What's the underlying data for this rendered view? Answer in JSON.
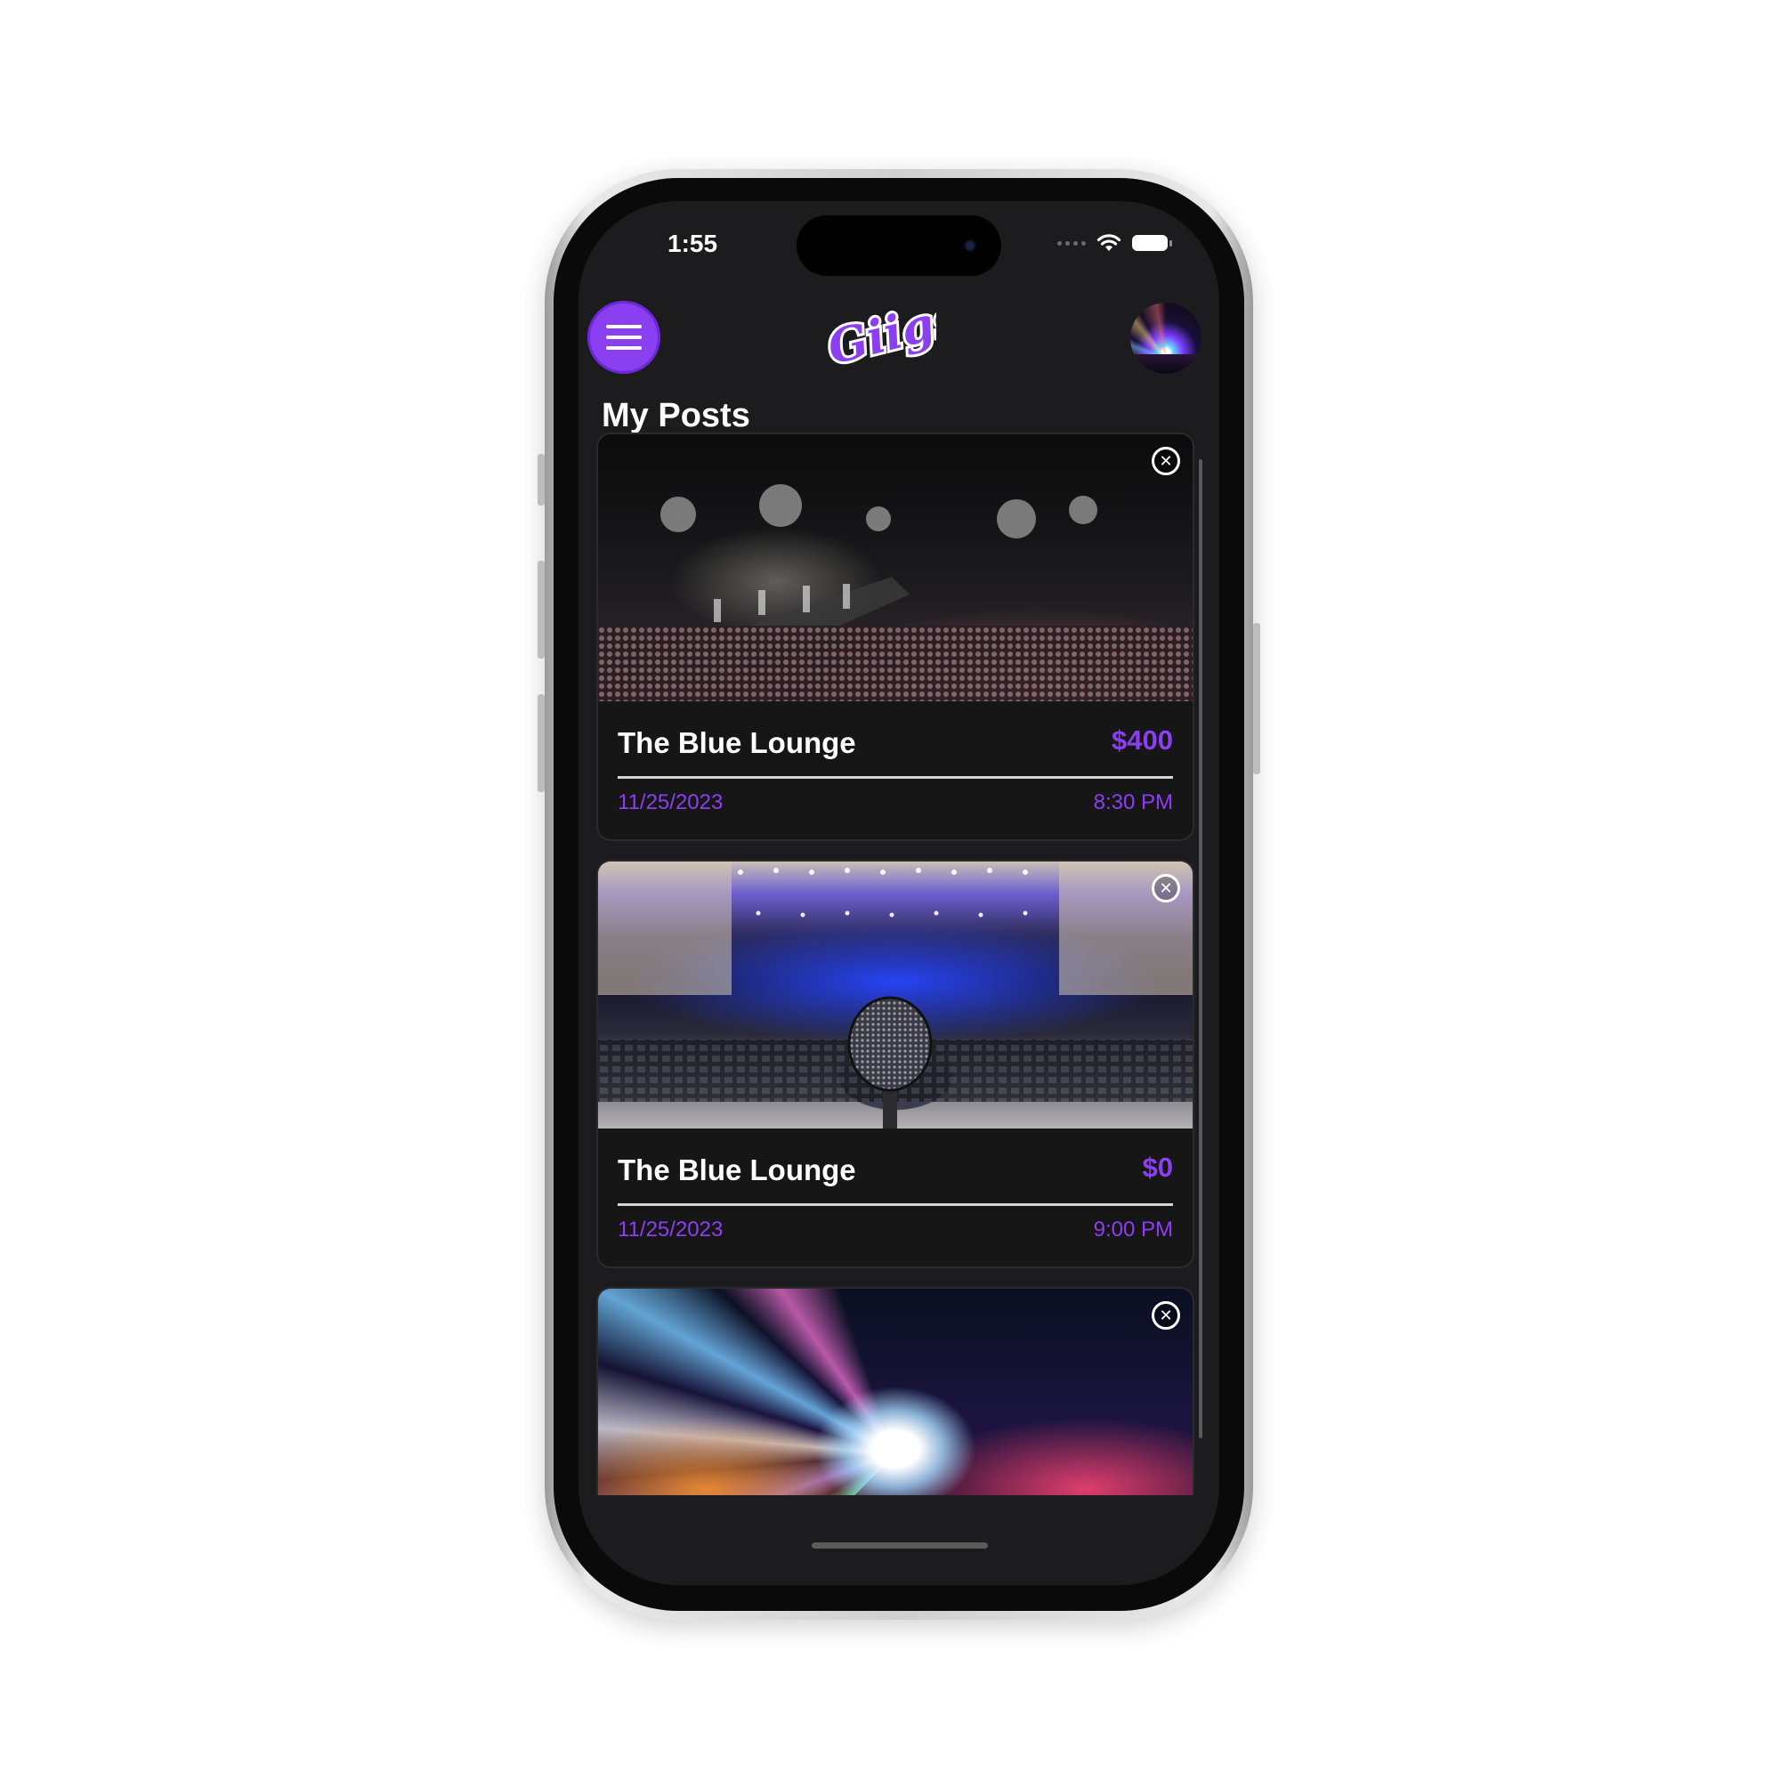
{
  "status_bar": {
    "time": "1:55"
  },
  "header": {
    "menu_icon": "hamburger-menu-icon",
    "logo_text": "Giigs",
    "avatar": "profile-avatar"
  },
  "page": {
    "title": "My Posts"
  },
  "posts": [
    {
      "image": "concert-crowd-photo",
      "title": "The Blue Lounge",
      "price": "$400",
      "date": "11/25/2023",
      "time": "8:30 PM",
      "close_icon": "✕"
    },
    {
      "image": "auditorium-microphone-photo",
      "title": "The Blue Lounge",
      "price": "$0",
      "date": "11/25/2023",
      "time": "9:00 PM",
      "close_icon": "✕"
    },
    {
      "image": "festival-lights-photo",
      "close_icon": "✕"
    }
  ],
  "colors": {
    "accent": "#8b3ff0",
    "background": "#1c1b1d",
    "card": "#171617"
  }
}
